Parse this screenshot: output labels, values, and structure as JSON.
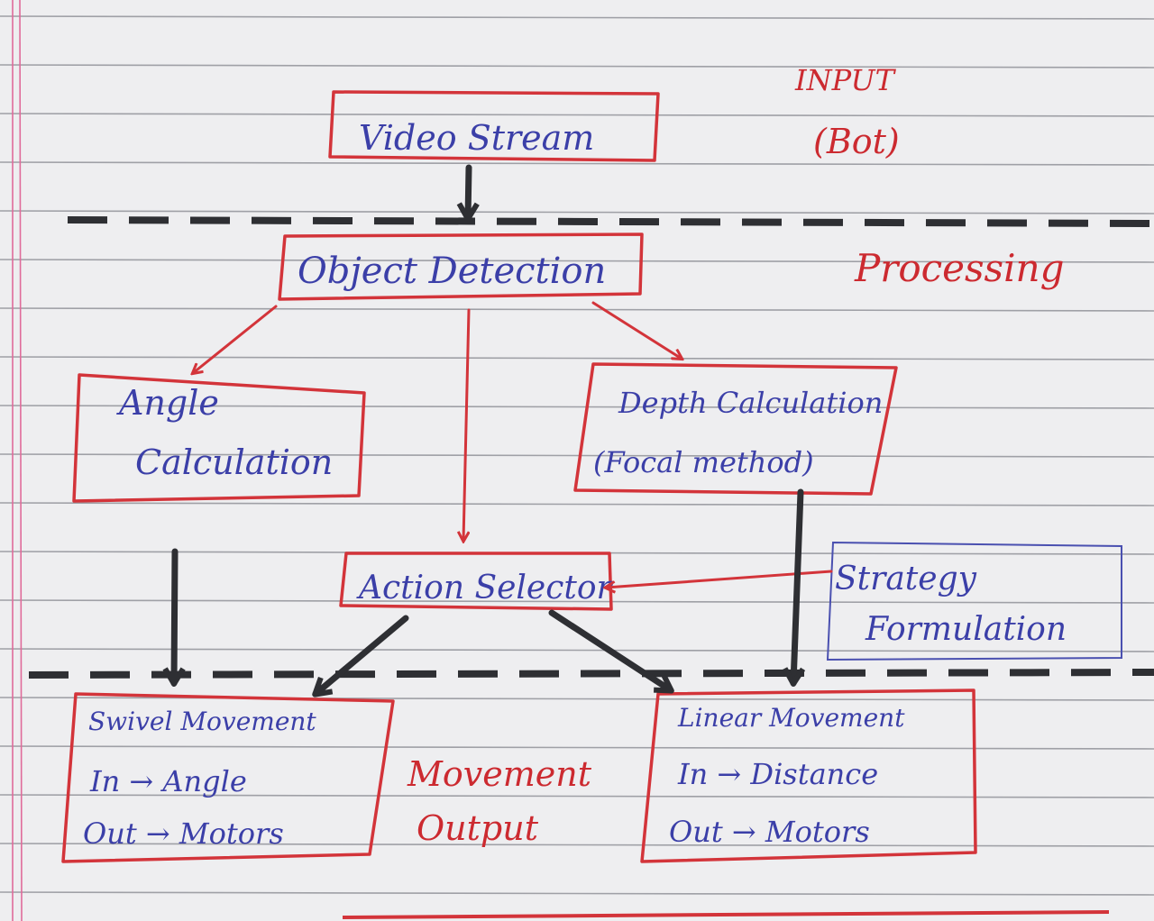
{
  "sections": {
    "input": [
      "INPUT",
      "(Bot)"
    ],
    "processing": "Processing",
    "output": [
      "Movement",
      "Output"
    ]
  },
  "nodes": {
    "video_stream": "Video Stream",
    "object_detection": "Object Detection",
    "angle_calculation": [
      "Angle",
      "Calculation"
    ],
    "depth_calculation": [
      "Depth Calculation",
      "(Focal method)"
    ],
    "action_selector": "Action Selector",
    "strategy_formulation": [
      "Strategy",
      "Formulation"
    ],
    "swivel_movement": [
      "Swivel Movement",
      "In → Angle",
      "Out → Motors"
    ],
    "linear_movement": [
      "Linear Movement",
      "In → Distance",
      "Out → Motors"
    ]
  },
  "colors": {
    "paper": "#eeeef0",
    "ink_red": "#d3343a",
    "ink_blue": "#3b3fa8",
    "ink_black": "#2e2f33",
    "ruled_line": "#9fa0a6",
    "margin_line": "#e06b9a"
  }
}
